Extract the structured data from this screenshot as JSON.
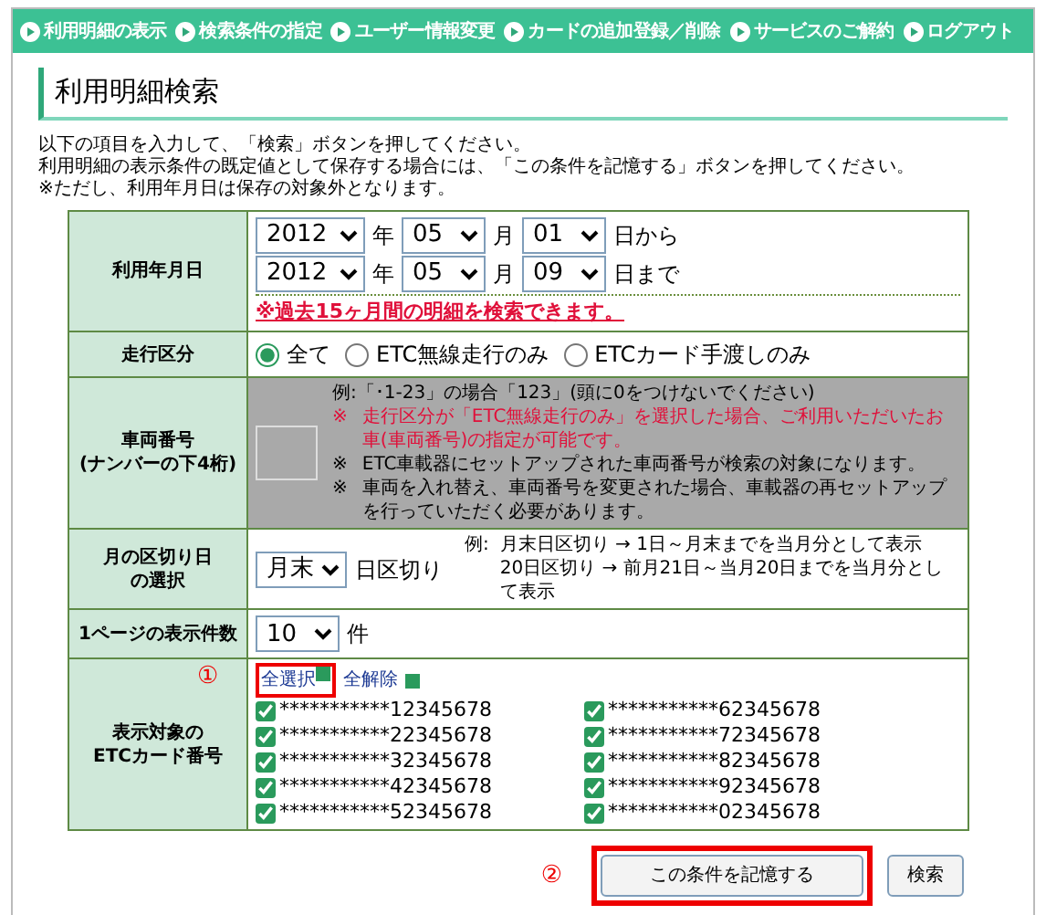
{
  "nav": [
    {
      "label": "利用明細の表示"
    },
    {
      "label": "検索条件の指定"
    },
    {
      "label": "ユーザー情報変更"
    },
    {
      "label": "カードの追加登録／削除"
    },
    {
      "label": "サービスのご解約"
    },
    {
      "label": "ログアウト"
    }
  ],
  "page_title": "利用明細検索",
  "intro": [
    "以下の項目を入力して、「検索」ボタンを押してください。",
    "利用明細の表示条件の既定値として保存する場合には、「この条件を記憶する」ボタンを押してください。",
    "※ただし、利用年月日は保存の対象外となります。"
  ],
  "form": {
    "date": {
      "label": "利用年月日",
      "ranges": [
        {
          "year": "2012",
          "year_unit": "年",
          "month": "05",
          "month_unit": "月",
          "day": "01",
          "suffix": "日から"
        },
        {
          "year": "2012",
          "year_unit": "年",
          "month": "05",
          "month_unit": "月",
          "day": "09",
          "suffix": "日まで"
        }
      ],
      "note": "※過去15ヶ月間の明細を検索できます。"
    },
    "run_type": {
      "label": "走行区分",
      "options": [
        {
          "label": "全て",
          "selected": true
        },
        {
          "label": "ETC無線走行のみ",
          "selected": false
        },
        {
          "label": "ETCカード手渡しのみ",
          "selected": false
        }
      ]
    },
    "vehicle": {
      "label": "車両番号",
      "sublabel": "(ナンバーの下4桁)",
      "disabled": true,
      "example": "例:「･1-23」の場合「123」(頭に0をつけないでください)",
      "notes": [
        {
          "mark": "※",
          "text": "走行区分が「ETC無線走行のみ」を選択した場合、ご利用いただいたお車(車両番号)の指定が可能です。",
          "kind": "warning"
        },
        {
          "mark": "※",
          "text": "ETC車載器にセットアップされた車両番号が検索の対象になります。",
          "kind": "info"
        },
        {
          "mark": "※",
          "text": "車両を入れ替え、車両番号を変更された場合、車載器の再セットアップを行っていただく必要があります。",
          "kind": "info"
        }
      ]
    },
    "cutoff": {
      "label_lines": [
        "月の区切り日",
        "の選択"
      ],
      "value": "月末",
      "unit": "日区切り",
      "example_label": "例:",
      "examples": [
        "月末日区切り → 1日～月末までを当月分として表示",
        "20日区切り → 前月21日～当月20日までを当月分として表示"
      ]
    },
    "per_page": {
      "label": "1ページの表示件数",
      "value": "10",
      "unit": "件"
    },
    "cards": {
      "label_lines": [
        "表示対象の",
        "ETCカード番号"
      ],
      "annotation": "①",
      "select_all": "全選択",
      "clear_all": "全解除",
      "items": [
        {
          "number": "***********12345678",
          "checked": true
        },
        {
          "number": "***********22345678",
          "checked": true
        },
        {
          "number": "***********32345678",
          "checked": true
        },
        {
          "number": "***********42345678",
          "checked": true
        },
        {
          "number": "***********52345678",
          "checked": true
        },
        {
          "number": "***********62345678",
          "checked": true
        },
        {
          "number": "***********72345678",
          "checked": true
        },
        {
          "number": "***********82345678",
          "checked": true
        },
        {
          "number": "***********92345678",
          "checked": true
        },
        {
          "number": "***********02345678",
          "checked": true
        }
      ]
    }
  },
  "buttons": {
    "annotation": "②",
    "save": "この条件を記憶する",
    "search": "検索"
  }
}
